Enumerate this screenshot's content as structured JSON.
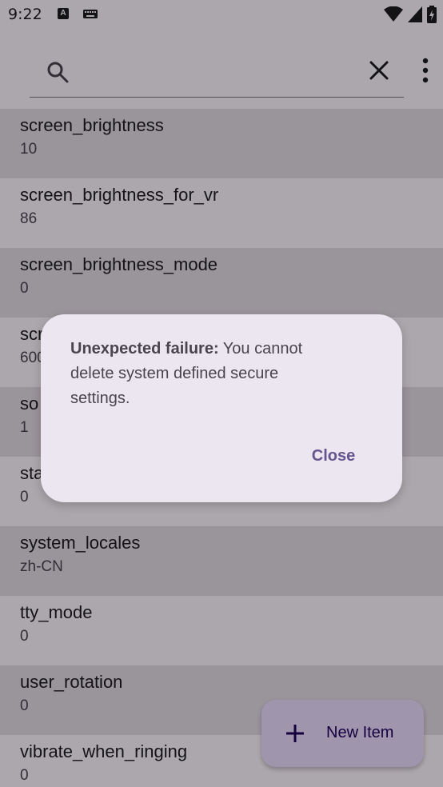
{
  "status_bar": {
    "time": "9:22",
    "a_icon_letter": "A"
  },
  "search": {
    "placeholder": "",
    "value": ""
  },
  "settings": [
    {
      "key": "screen_brightness",
      "value": "10"
    },
    {
      "key": "screen_brightness_for_vr",
      "value": "86"
    },
    {
      "key": "screen_brightness_mode",
      "value": "0"
    },
    {
      "key": "scr",
      "value": "600"
    },
    {
      "key": "so",
      "value": "1"
    },
    {
      "key": "sta",
      "value": "0"
    },
    {
      "key": "system_locales",
      "value": "zh-CN"
    },
    {
      "key": "tty_mode",
      "value": "0"
    },
    {
      "key": "user_rotation",
      "value": "0"
    },
    {
      "key": "vibrate_when_ringing",
      "value": "0"
    }
  ],
  "fab": {
    "label": "New Item",
    "icon": "plus-icon"
  },
  "dialog": {
    "title_bold": "Unexpected failure:",
    "message": " You cannot delete system defined secure settings.",
    "close_label": "Close"
  },
  "colors": {
    "accent": "#65558f",
    "fab_bg": "#eaddff",
    "dialog_bg": "#ece6f0"
  }
}
